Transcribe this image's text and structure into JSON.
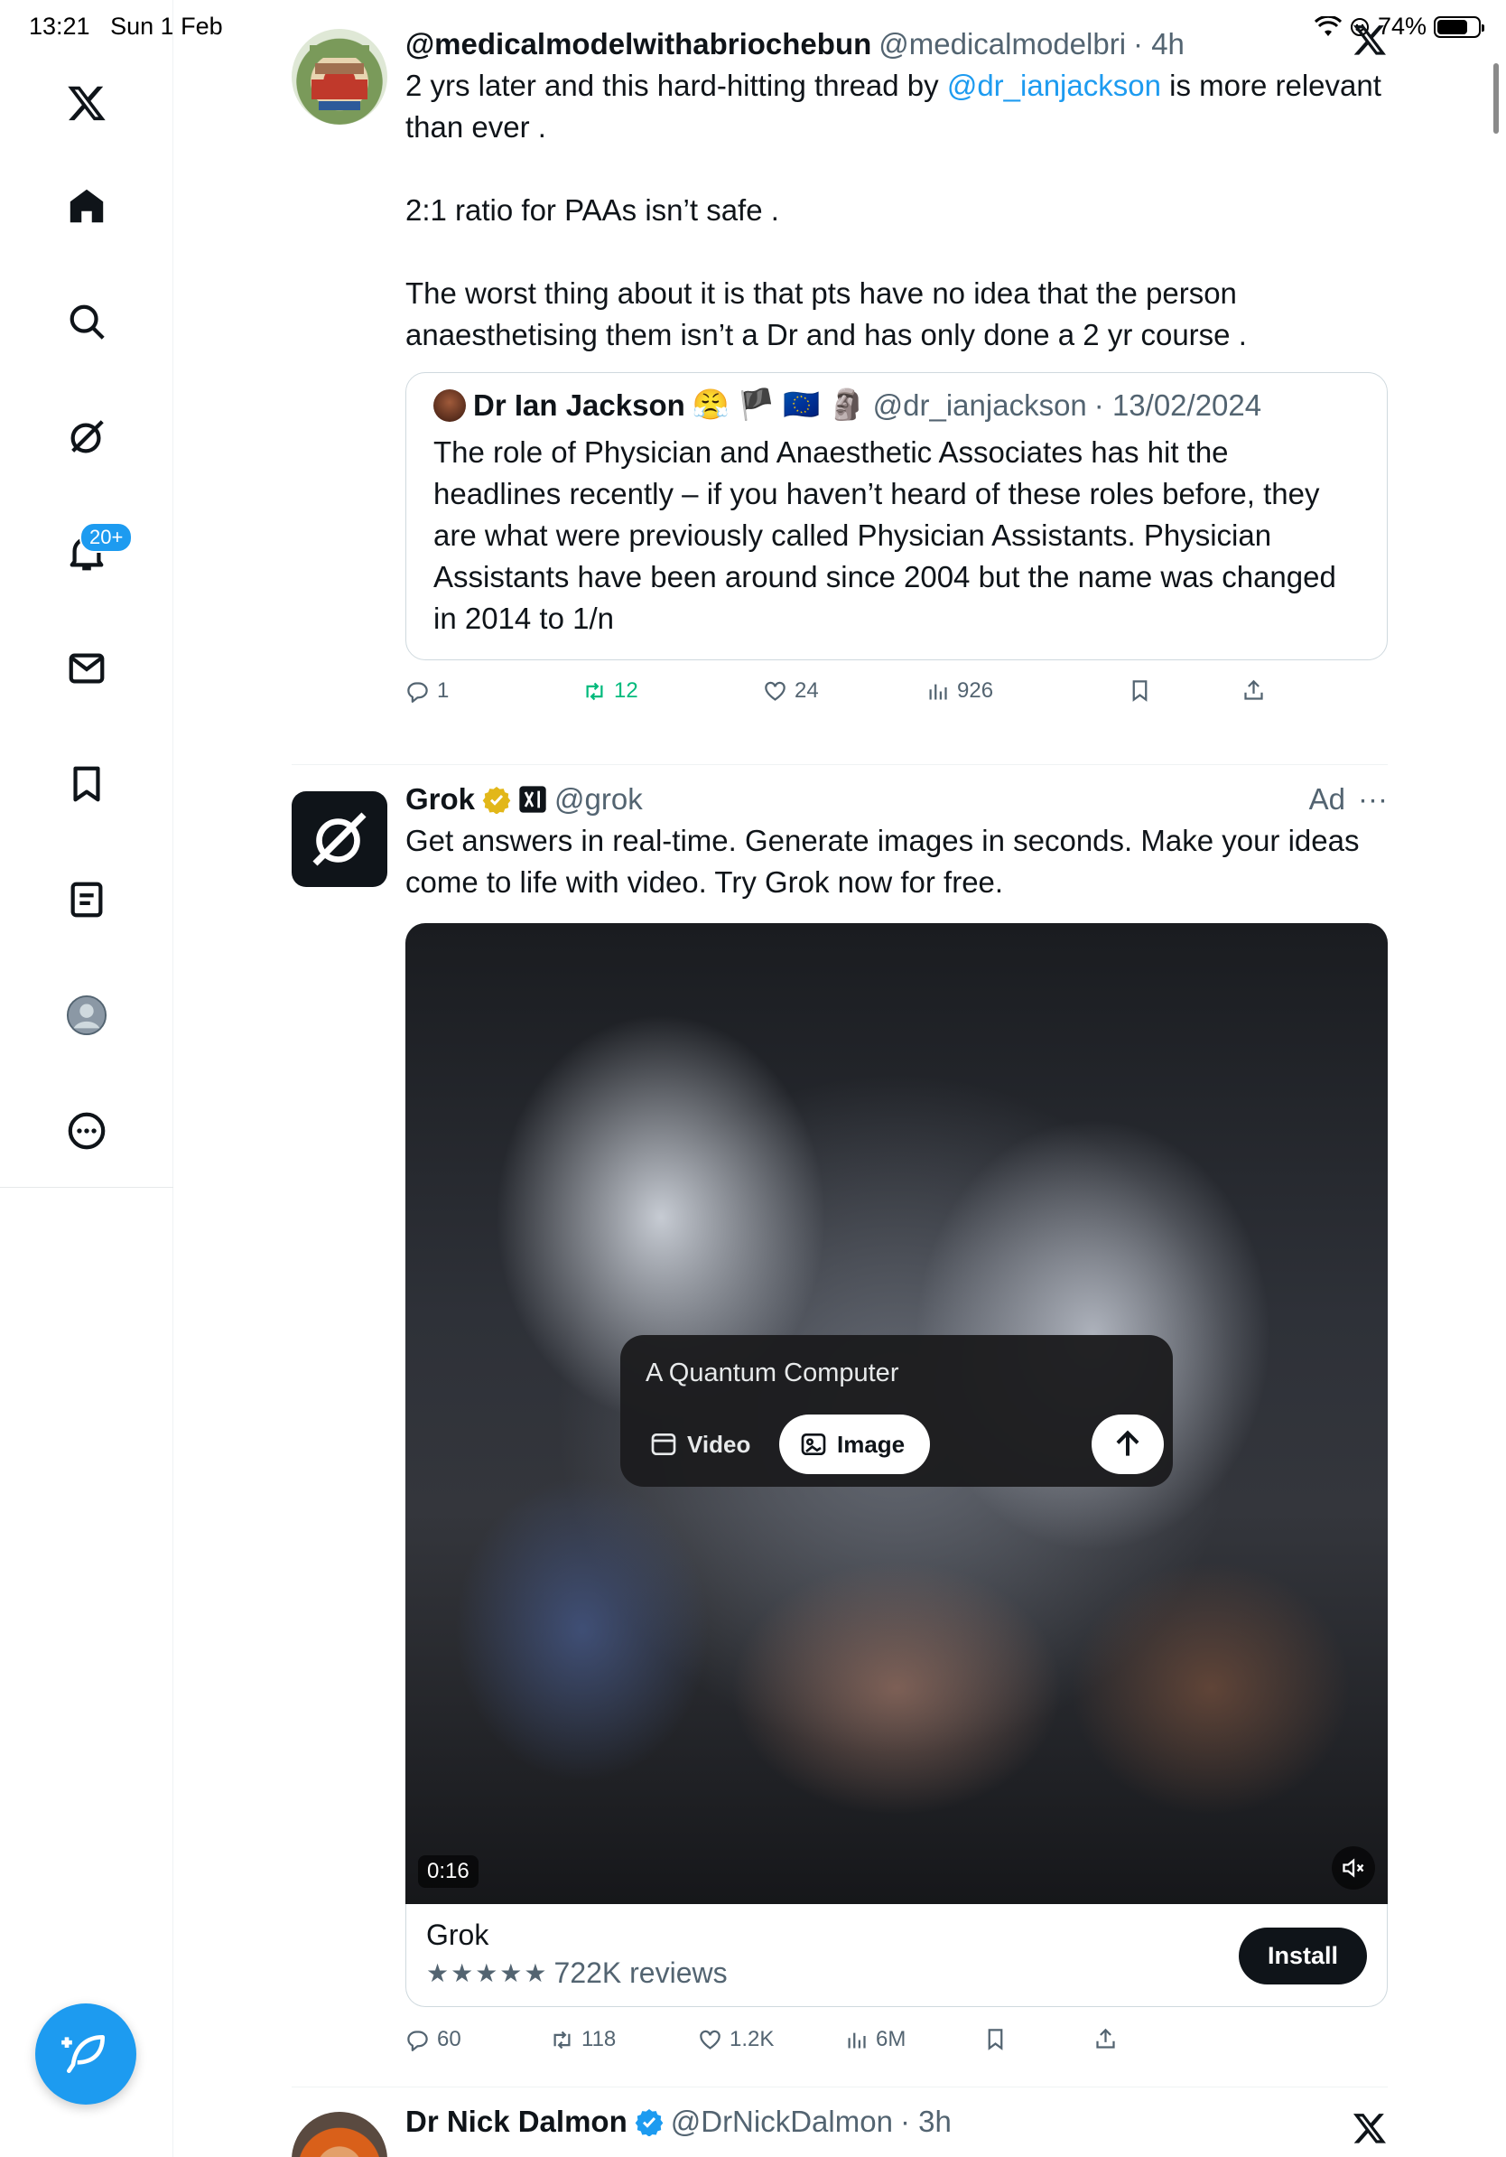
{
  "status_bar": {
    "time": "13:21",
    "date": "Sun 1 Feb",
    "battery": "74%",
    "battery_level": 0.74
  },
  "sidebar": {
    "items": [
      {
        "name": "x-logo-icon"
      },
      {
        "name": "home-icon"
      },
      {
        "name": "search-icon"
      },
      {
        "name": "grok-icon"
      },
      {
        "name": "notifications-icon"
      },
      {
        "name": "messages-icon"
      },
      {
        "name": "bookmarks-icon"
      },
      {
        "name": "lists-icon"
      },
      {
        "name": "profile-icon"
      },
      {
        "name": "more-icon"
      }
    ],
    "notif_badge": "20+"
  },
  "post1": {
    "name": "@medicalmodelwithabriochebun",
    "handle": "@medicalmodelbri",
    "time": "· 4h",
    "text_line1_a": "2 yrs later and this hard-hitting  thread by ",
    "text_link": "@dr_ianjackson",
    "text_line1_b": " is more relevant than ever .",
    "text_p2": "2:1 ratio for PAAs isn’t safe .",
    "text_p3": "The worst thing about it is that pts have no idea that the person anaesthetising them isn’t a Dr and has only done a 2 yr course .",
    "quote": {
      "name": "Dr Ian Jackson",
      "emojis": "😤 🏴 🇪🇺 🗿",
      "handle": "@dr_ianjackson",
      "date": "· 13/02/2024",
      "text": "The role of Physician and Anaesthetic Associates has hit the headlines recently – if you haven’t heard of these roles before, they are what were previously called Physician Assistants. Physician Assistants have been around since 2004 but the name was changed in 2014 to 1/n"
    },
    "actions": {
      "replies": "1",
      "reposts": "12",
      "likes": "24",
      "views": "926"
    }
  },
  "post2": {
    "name": "Grok",
    "handle": "@grok",
    "ad_label": "Ad",
    "more": "···",
    "text": "Get answers in real-time. Generate images in seconds. Make your ideas come to life with video. Try Grok now for free.",
    "media": {
      "prompt": "A Quantum Computer",
      "chip_video": "Video",
      "chip_image": "Image",
      "duration": "0:16"
    },
    "app_card": {
      "app_name": "Grok",
      "stars": "★★★★★",
      "reviews": "722K reviews",
      "install": "Install"
    },
    "actions": {
      "replies": "60",
      "reposts": "118",
      "likes": "1.2K",
      "views": "6M"
    }
  },
  "post3": {
    "name": "Dr Nick Dalmon",
    "handle": "@DrNickDalmon",
    "time": "· 3h"
  },
  "colors": {
    "accent": "#1d9bf0",
    "repost_green": "#00ba7c",
    "text": "#0f1419",
    "muted": "#536471"
  }
}
